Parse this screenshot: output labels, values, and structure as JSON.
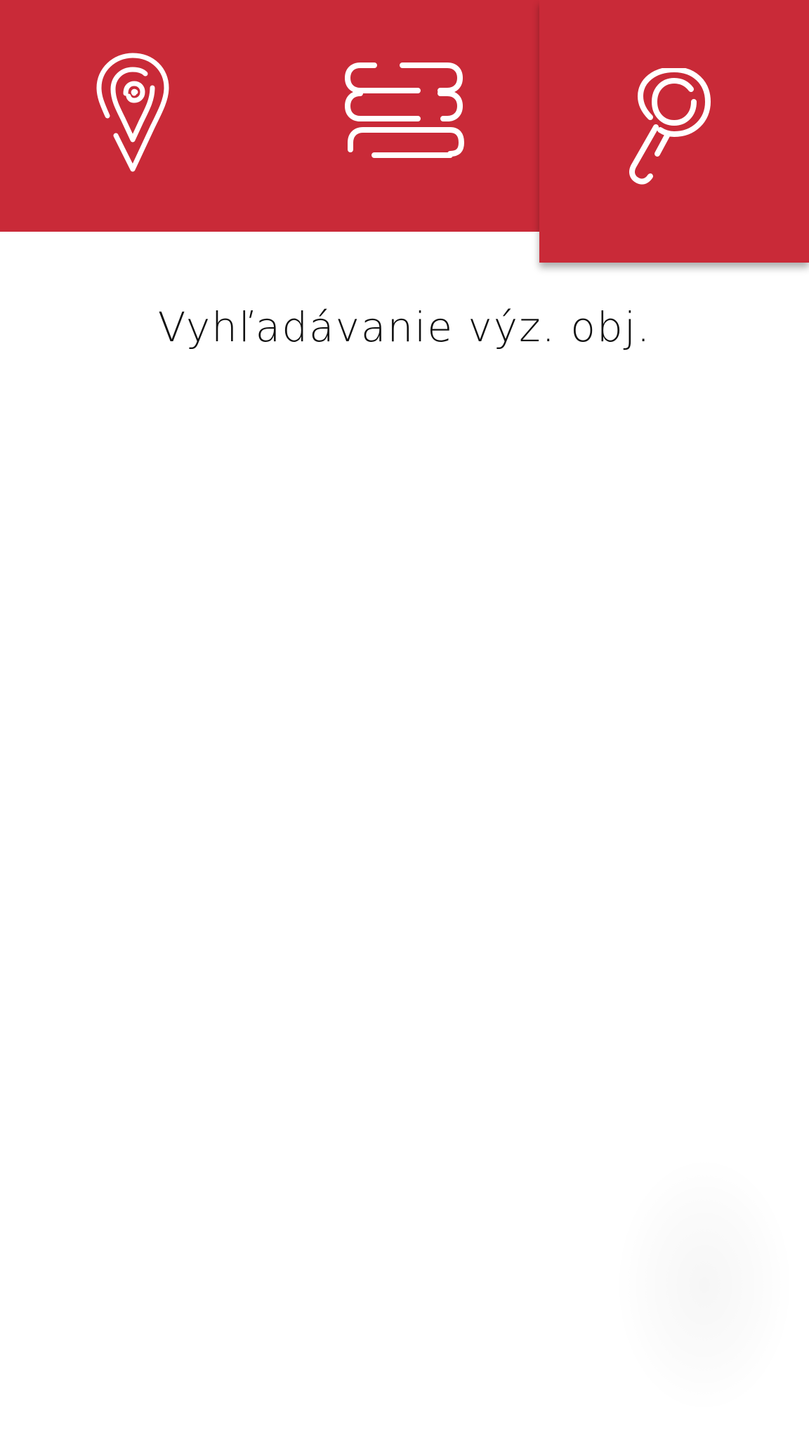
{
  "header": {
    "background_color": "#c92a38",
    "tabs": [
      {
        "name": "map",
        "icon": "location-pin-icon",
        "active": false
      },
      {
        "name": "list",
        "icon": "list-icon",
        "active": false
      },
      {
        "name": "search",
        "icon": "search-icon",
        "active": true
      }
    ]
  },
  "main": {
    "title": "Vyhľadávanie výz. obj."
  }
}
